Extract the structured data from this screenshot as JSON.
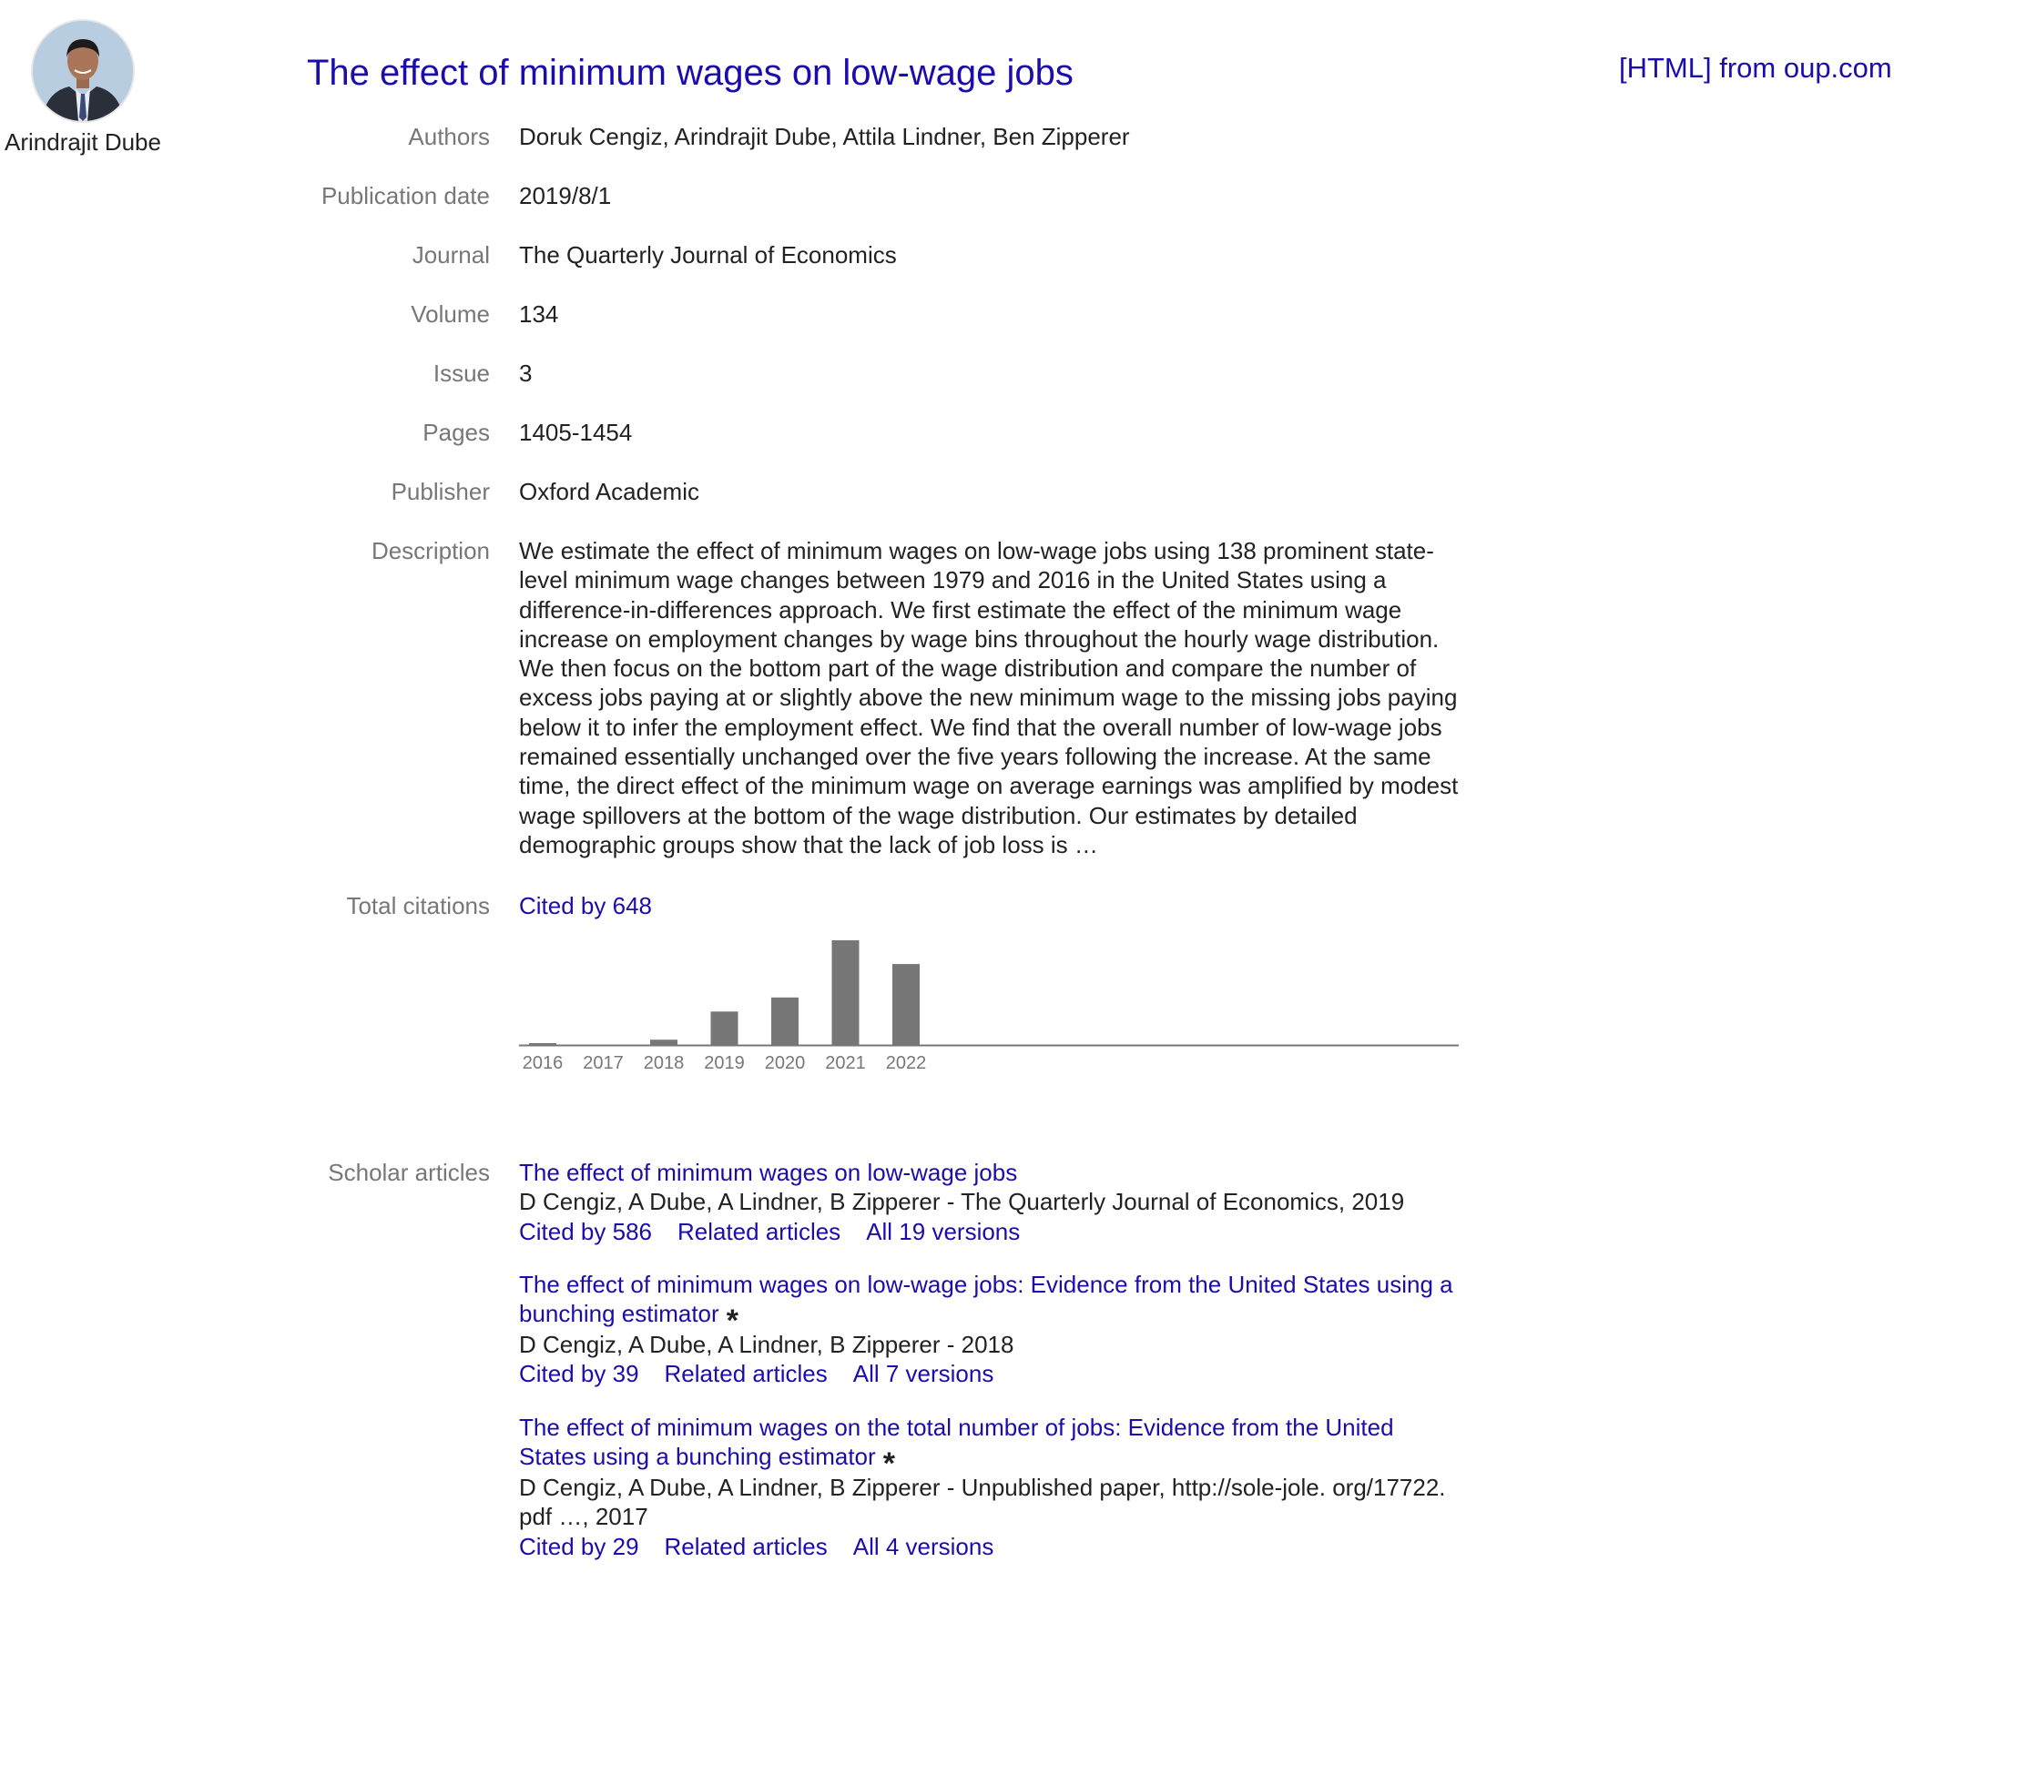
{
  "profile": {
    "name": "Arindrajit Dube"
  },
  "title": "The effect of minimum wages on low-wage jobs",
  "html_link": "[HTML] from oup.com",
  "fields": {
    "authors": {
      "label": "Authors",
      "value": "Doruk Cengiz, Arindrajit Dube, Attila Lindner, Ben Zipperer"
    },
    "publication_date": {
      "label": "Publication date",
      "value": "2019/8/1"
    },
    "journal": {
      "label": "Journal",
      "value": "The Quarterly Journal of Economics"
    },
    "volume": {
      "label": "Volume",
      "value": "134"
    },
    "issue": {
      "label": "Issue",
      "value": "3"
    },
    "pages": {
      "label": "Pages",
      "value": "1405-1454"
    },
    "publisher": {
      "label": "Publisher",
      "value": "Oxford Academic"
    },
    "description": {
      "label": "Description",
      "value": "We estimate the effect of minimum wages on low-wage jobs using 138 prominent state-level minimum wage changes between 1979 and 2016 in the United States using a difference-in-differences approach. We first estimate the effect of the minimum wage increase on employment changes by wage bins throughout the hourly wage distribution. We then focus on the bottom part of the wage distribution and compare the number of excess jobs paying at or slightly above the new minimum wage to the missing jobs paying below it to infer the employment effect. We find that the overall number of low-wage jobs remained essentially unchanged over the five years following the increase. At the same time, the direct effect of the minimum wage on average earnings was amplified by modest wage spillovers at the bottom of the wage distribution. Our estimates by detailed demographic groups show that the lack of job loss is …"
    },
    "total_citations": {
      "label": "Total citations",
      "value": "Cited by 648"
    },
    "scholar_articles": {
      "label": "Scholar articles"
    }
  },
  "chart_data": {
    "type": "bar",
    "categories": [
      "2016",
      "2017",
      "2018",
      "2019",
      "2020",
      "2021",
      "2022"
    ],
    "values": [
      2,
      0,
      6,
      38,
      54,
      119,
      92
    ],
    "ylim": [
      0,
      119
    ],
    "bar_color": "#777777",
    "axis_color": "#777777"
  },
  "scholar_articles": [
    {
      "title": "The effect of minimum wages on low-wage jobs",
      "starred": false,
      "authors": "D Cengiz, A Dube, A Lindner, B Zipperer - The Quarterly Journal of Economics, 2019",
      "cited_by": "Cited by 586",
      "related": "Related articles",
      "versions": "All 19 versions"
    },
    {
      "title": "The effect of minimum wages on low-wage jobs: Evidence from the United States using a bunching estimator",
      "starred": true,
      "star": "*",
      "authors": "D Cengiz, A Dube, A Lindner, B Zipperer - 2018",
      "cited_by": "Cited by 39",
      "related": "Related articles",
      "versions": "All 7 versions"
    },
    {
      "title": "The effect of minimum wages on the total number of jobs: Evidence from the United States using a bunching estimator",
      "starred": true,
      "star": "*",
      "authors": "D Cengiz, A Dube, A Lindner, B Zipperer - Unpublished paper, http://sole-jole. org/17722. pdf …, 2017",
      "cited_by": "Cited by 29",
      "related": "Related articles",
      "versions": "All 4 versions"
    }
  ],
  "colors": {
    "link": "#1a0dab",
    "label": "#777777",
    "text": "#222222"
  }
}
